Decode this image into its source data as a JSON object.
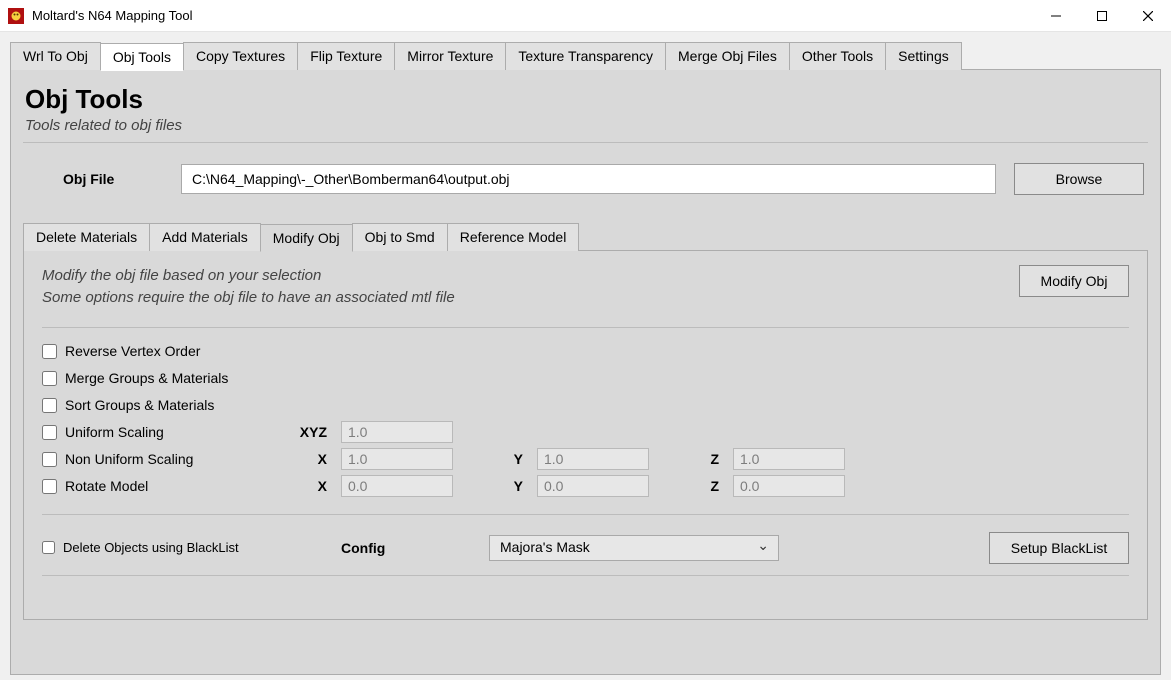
{
  "window": {
    "title": "Moltard's N64 Mapping Tool"
  },
  "tabs": {
    "items": [
      {
        "label": "Wrl To Obj"
      },
      {
        "label": "Obj Tools"
      },
      {
        "label": "Copy Textures"
      },
      {
        "label": "Flip Texture"
      },
      {
        "label": "Mirror Texture"
      },
      {
        "label": "Texture Transparency"
      },
      {
        "label": "Merge Obj Files"
      },
      {
        "label": "Other Tools"
      },
      {
        "label": "Settings"
      }
    ],
    "active_index": 1
  },
  "page": {
    "title": "Obj Tools",
    "subtitle": "Tools related to obj files"
  },
  "obj_file": {
    "label": "Obj File",
    "value": "C:\\N64_Mapping\\-_Other\\Bomberman64\\output.obj",
    "browse": "Browse"
  },
  "inner_tabs": {
    "items": [
      {
        "label": "Delete Materials"
      },
      {
        "label": "Add Materials"
      },
      {
        "label": "Modify Obj"
      },
      {
        "label": "Obj to Smd"
      },
      {
        "label": "Reference Model"
      }
    ],
    "active_index": 2
  },
  "modify": {
    "desc1": "Modify the obj file based on your selection",
    "desc2": "Some options require the obj file to have an associated mtl file",
    "button": "Modify Obj",
    "checks": {
      "reverse_vertex": "Reverse Vertex Order",
      "merge_groups": "Merge Groups & Materials",
      "sort_groups": "Sort Groups & Materials",
      "uniform_scaling": "Uniform Scaling",
      "non_uniform_scaling": "Non Uniform Scaling",
      "rotate_model": "Rotate Model",
      "delete_blacklist": "Delete Objects using BlackList"
    },
    "axes": {
      "xyz": "XYZ",
      "x": "X",
      "y": "Y",
      "z": "Z"
    },
    "values": {
      "uniform_xyz": "1.0",
      "nonuniform_x": "1.0",
      "nonuniform_y": "1.0",
      "nonuniform_z": "1.0",
      "rotate_x": "0.0",
      "rotate_y": "0.0",
      "rotate_z": "0.0"
    },
    "config_label": "Config",
    "config_selected": "Majora's Mask",
    "setup_blacklist": "Setup BlackList"
  }
}
